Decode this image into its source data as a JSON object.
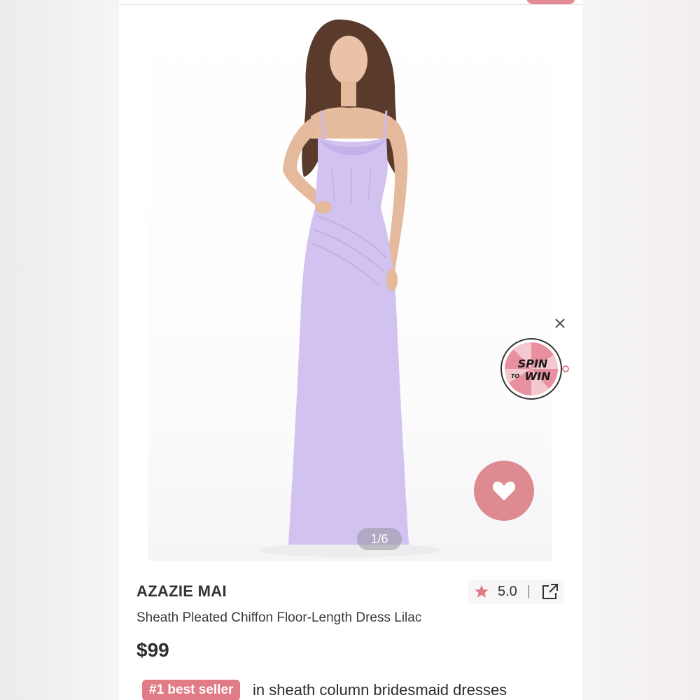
{
  "image_counter": "1/6",
  "promo": {
    "line1": "SPIN",
    "line2_small": "TO",
    "line2": "WIN"
  },
  "product": {
    "brand": "AZAZIE MAI",
    "name": "Sheath Pleated Chiffon Floor-Length Dress Lilac",
    "price": "$99",
    "rating": "5.0"
  },
  "bestseller": {
    "badge": "#1 best seller",
    "text": "in sheath column bridesmaid dresses"
  },
  "icons": {
    "close": "close-icon",
    "heart": "heart-icon",
    "star": "star-icon",
    "share": "share-icon"
  },
  "colors": {
    "accent_pink": "#de8a91",
    "dress_lilac": "#d2c2f0",
    "star": "#e07a86"
  }
}
